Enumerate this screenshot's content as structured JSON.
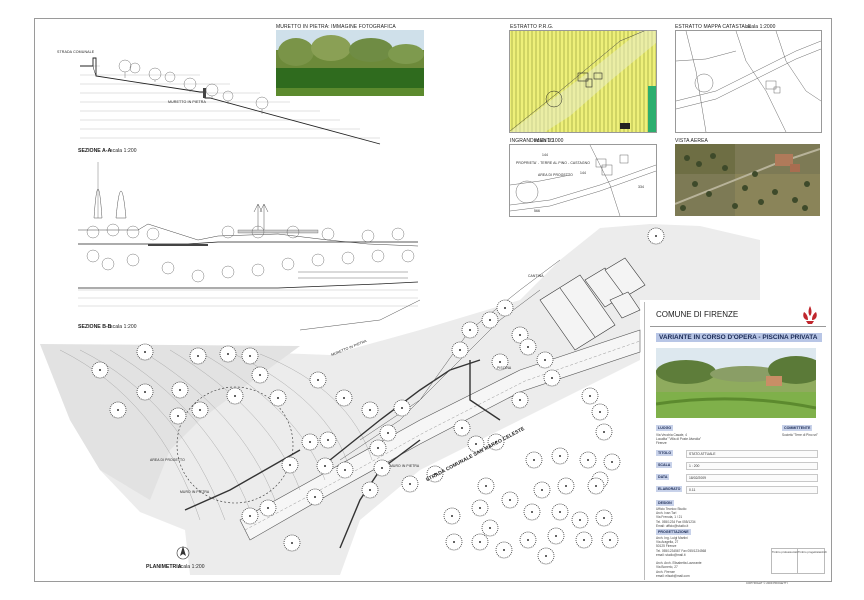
{
  "sections": {
    "photo_title": "MURETTO IN PIETRA: IMMAGINE FOTOGRAFICA",
    "section_a_title": "SEZIONE A-A",
    "section_a_scale": "scala 1:200",
    "section_b_title": "SEZIONE B-B",
    "section_b_scale": "scala 1:200",
    "strada_label": "STRADA COMUNALE",
    "muretto_label": "MURETTO IN PIETRA",
    "prg_title": "ESTRATTO P.R.G.",
    "catasto_title": "ESTRATTO MAPPA CATASTALE",
    "catasto_scale": "scala 1:2000",
    "ingrandimento_title": "INGRANDIMENTO",
    "ingrandimento_scale": "scala 1:1000",
    "aerea_title": "VISTA AEREA",
    "planimetria_title": "PLANIMETRIA",
    "planimetria_scale": "scala 1:200",
    "road_label": "STRADA COMUNALE SAN MARCO CELESTE",
    "muretto_plan": "MURETTO IN PIETRA",
    "area_progetto": "AREA DI PROGETTO",
    "muro_pietra": "MURO IN PIETRA",
    "proprieta": "PROPRIETA' - TERRE AL PINO - CASTAGNO",
    "ing_area": "AREA DI PROGETTO",
    "ing_num_1": "144",
    "ing_num_2": "334",
    "ing_num_3": "144",
    "ing_num_4": "566",
    "garage_label": "CANTINA",
    "garage_label2": "PISCINA"
  },
  "titleblock": {
    "comune": "COMUNE DI FIRENZE",
    "project": "VARIANTE IN CORSO D'OPERA - PISCINA PRIVATA",
    "luogo_key": "LUOGO",
    "committente_key": "COMMITTENTE",
    "luogo_text": "Via Vecchia Casale, 4\nLocalita' \"Villa di Poste Alveolia\"\nFirenze",
    "committente_text": "Società \"Terre di Pino srl\"",
    "titolo_key": "TITOLO",
    "titolo_val": "STATO ATTUALE",
    "scala_key": "SCALA",
    "scala_val": "1 : 200",
    "data_key": "DATA",
    "data_val": "18/02/2009",
    "elaborato_key": "ELABORATO",
    "elaborato_val": "0.11",
    "design_key": "DESIGN",
    "design_text": "Ufficio Tecnico Studio\nArch. Ivan Tori\nVia Frenuta, 1 / 21\nTel. 055/1234 Fax 055/1234\nEmail: ufficio@studio.it",
    "progettazione_key": "PROGETTAZIONE",
    "progettazione_text": "Arch. Ing. Luigi Martini\nVia Aragella, 27\n50125 Firenze\nTel. 055/1234567 Fax 055/1234568\nemail: studio@mail.it\n\nArch. Arch. Elisabetta Lavorante\nVia Bonerio, 27\nArch. Firenze\nemail: elisab@mail.com",
    "firma1": "Timbro professionisti",
    "firma2": "Timbro progettista/Arch",
    "copyright": "COPYRIGHT © 2009 PROGETTI"
  }
}
